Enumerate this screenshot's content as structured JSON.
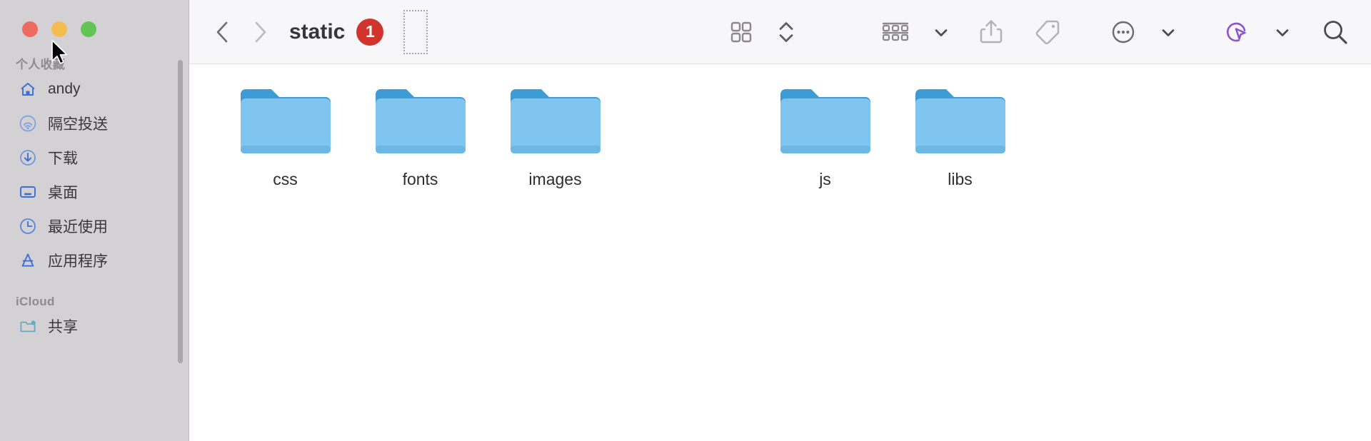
{
  "window": {
    "traffic_lights": [
      {
        "name": "close",
        "color": "#ee6a5f"
      },
      {
        "name": "minimize",
        "color": "#f5bd4f"
      },
      {
        "name": "maximize",
        "color": "#61c454"
      }
    ]
  },
  "sidebar": {
    "sections": [
      {
        "header": "个人收藏",
        "items": [
          {
            "label": "andy",
            "icon": "home-icon"
          },
          {
            "label": "隔空投送",
            "icon": "airdrop-icon"
          },
          {
            "label": "下载",
            "icon": "downloads-icon"
          },
          {
            "label": "桌面",
            "icon": "desktop-icon"
          },
          {
            "label": "最近使用",
            "icon": "clock-icon"
          },
          {
            "label": "应用程序",
            "icon": "applications-icon"
          }
        ]
      },
      {
        "header": "iCloud",
        "items": [
          {
            "label": "共享",
            "icon": "shared-folder-icon"
          }
        ]
      }
    ]
  },
  "toolbar": {
    "back_label": "‹",
    "forward_label": "›",
    "title": "static",
    "badge_count": "1",
    "badge_color": "#d0342c",
    "buttons": [
      {
        "name": "icon-view-button",
        "icon": "grid-view-icon"
      },
      {
        "name": "view-stepper",
        "icon": "chevron-up-down-icon"
      },
      {
        "name": "group-by-button",
        "icon": "group-rows-icon"
      },
      {
        "name": "group-by-chevron",
        "icon": "chevron-down-icon"
      },
      {
        "name": "share-button",
        "icon": "share-icon"
      },
      {
        "name": "tag-button",
        "icon": "tag-icon"
      },
      {
        "name": "more-actions-button",
        "icon": "ellipsis-circle-icon"
      },
      {
        "name": "more-chevron",
        "icon": "chevron-down-icon"
      },
      {
        "name": "shortcuts-button",
        "icon": "shortcuts-cursor-icon"
      },
      {
        "name": "shortcuts-chevron",
        "icon": "chevron-down-icon"
      },
      {
        "name": "search-button",
        "icon": "search-icon"
      }
    ],
    "accent_purple": "#8c52c9"
  },
  "content": {
    "folder_color_body": "#7fc5ef",
    "folder_color_tab": "#3d9bd5",
    "items": [
      {
        "label": "css",
        "type": "folder",
        "empty": false
      },
      {
        "label": "fonts",
        "type": "folder",
        "empty": false
      },
      {
        "label": "images",
        "type": "folder",
        "empty": false
      },
      {
        "label": "",
        "type": "empty",
        "empty": true
      },
      {
        "label": "js",
        "type": "folder",
        "empty": false
      },
      {
        "label": "libs",
        "type": "folder",
        "empty": false
      }
    ]
  }
}
